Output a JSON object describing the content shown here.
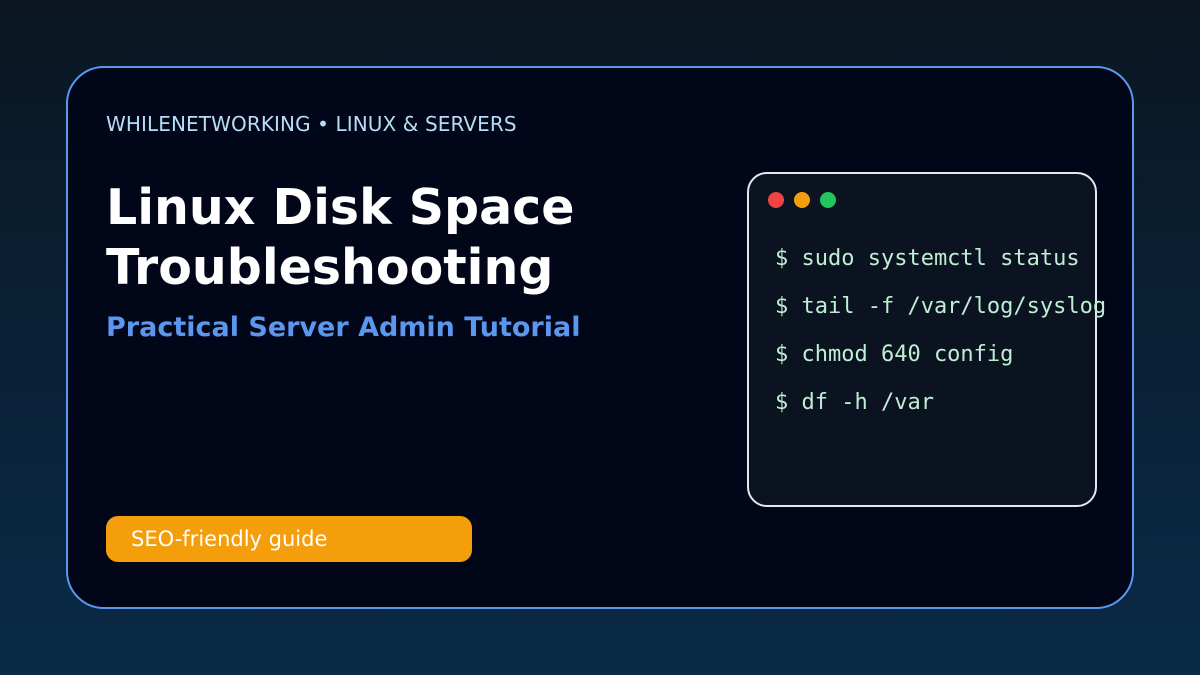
{
  "card": {
    "eyebrow": "WHILENETWORKING • LINUX & SERVERS",
    "title_lines": [
      "Linux Disk Space",
      "Troubleshooting"
    ],
    "subtitle": "Practical Server Admin Tutorial",
    "badge": "SEO-friendly guide"
  },
  "terminal": {
    "window_controls": [
      "close-dot",
      "minimize-dot",
      "maximize-dot"
    ],
    "commands": [
      "$ sudo systemctl status",
      "$ tail -f /var/log/syslog",
      "$ chmod 640 config",
      "$ df -h /var"
    ]
  },
  "colors": {
    "background_top": "#0b1621",
    "background_bottom": "#0a2a46",
    "card_fill": "#020619",
    "card_border": "#5b97ee",
    "eyebrow_text": "#b9dcf6",
    "title_text": "#ffffff",
    "subtitle_text": "#5b97ee",
    "badge_fill": "#f59e0b",
    "terminal_fill": "#0b1220",
    "terminal_border": "#e2e8f0",
    "terminal_text": "#bfeed3",
    "dot_red": "#ef4444",
    "dot_yellow": "#f59e0b",
    "dot_green": "#22c55e"
  }
}
